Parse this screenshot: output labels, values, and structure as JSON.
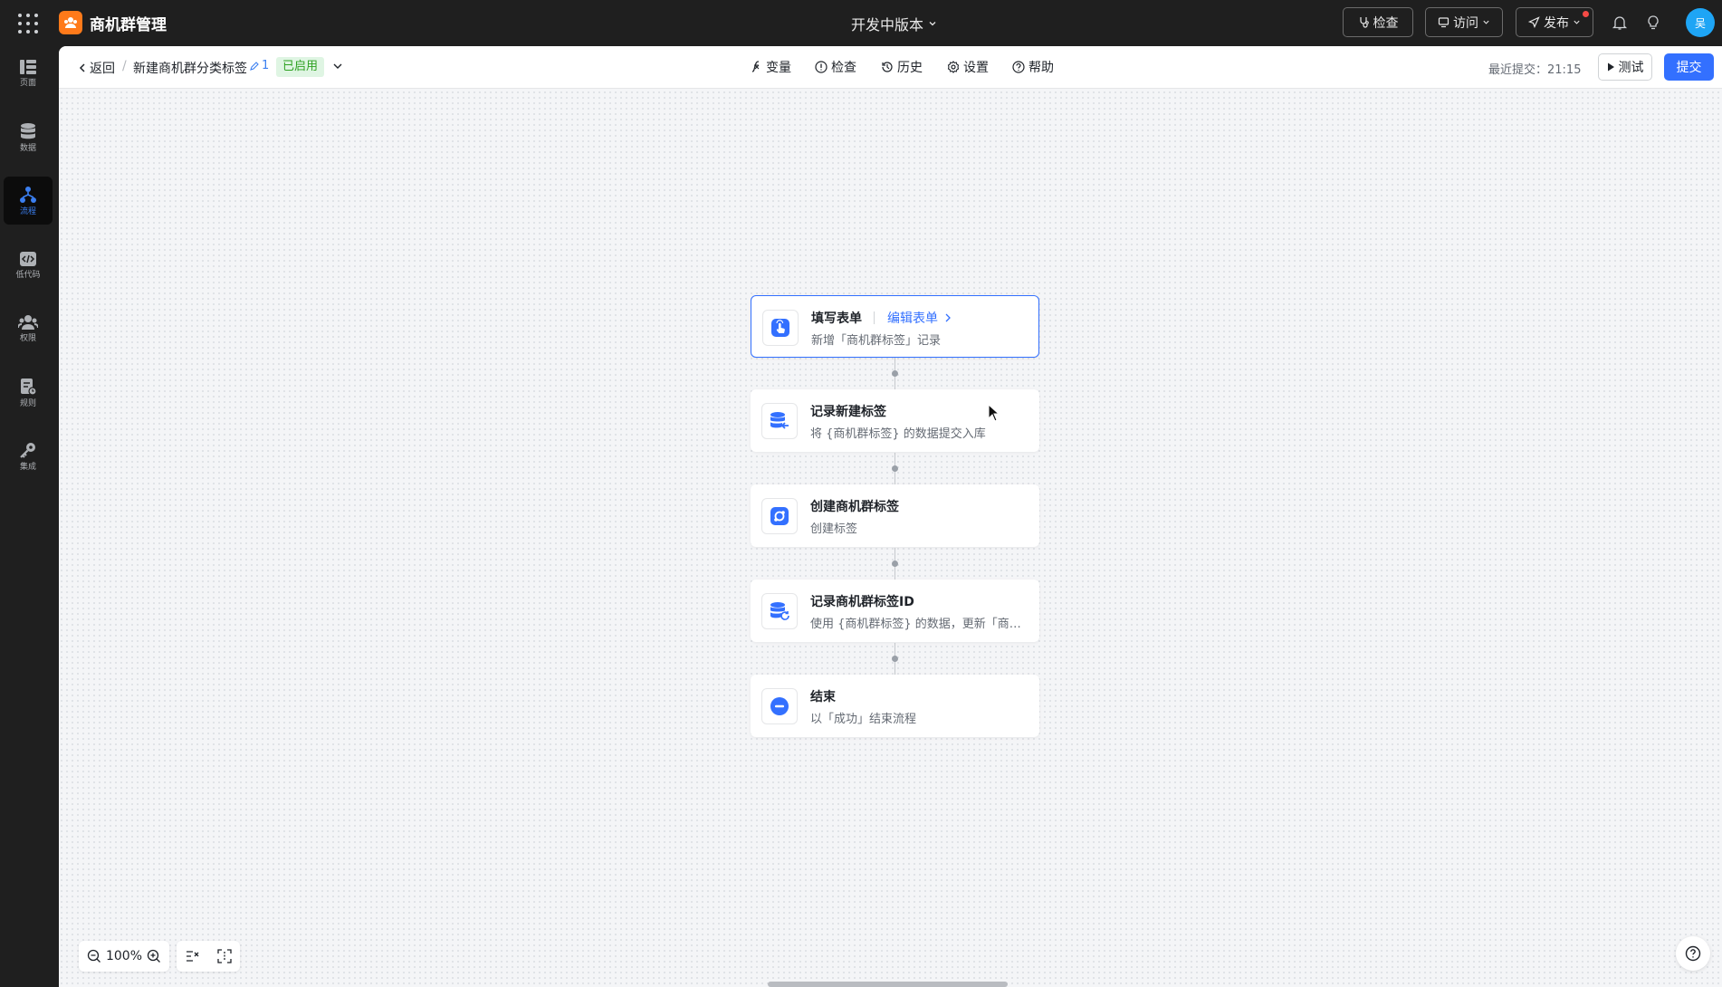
{
  "app": {
    "title": "商机群管理",
    "version_label": "开发中版本"
  },
  "topbar": {
    "check_label": "检查",
    "visit_label": "访问",
    "publish_label": "发布",
    "avatar_text": "吴"
  },
  "sidebar": {
    "items": [
      {
        "label": "页面",
        "icon": "page-icon"
      },
      {
        "label": "数据",
        "icon": "database-icon"
      },
      {
        "label": "流程",
        "icon": "flow-icon",
        "active": true
      },
      {
        "label": "低代码",
        "icon": "code-icon"
      },
      {
        "label": "权限",
        "icon": "users-icon"
      },
      {
        "label": "规则",
        "icon": "rule-icon"
      },
      {
        "label": "集成",
        "icon": "key-icon"
      }
    ]
  },
  "subbar": {
    "back_label": "返回",
    "separator": "/",
    "flow_name": "新建商机群分类标签",
    "version_num": "1",
    "status": "已启用",
    "tools": [
      "变量",
      "检查",
      "历史",
      "设置",
      "帮助"
    ],
    "last_commit": "最近提交：21:15",
    "test_label": "测试",
    "submit_label": "提交"
  },
  "nodes": [
    {
      "title": "填写表单",
      "link": "编辑表单",
      "desc": "新增「商机群标签」记录",
      "icon": "hand-pointer-icon"
    },
    {
      "title": "记录新建标签",
      "desc": "将 {商机群标签} 的数据提交入库",
      "icon": "db-import-icon"
    },
    {
      "title": "创建商机群标签",
      "desc": "创建标签",
      "icon": "connector-icon"
    },
    {
      "title": "记录商机群标签ID",
      "desc": "使用 {商机群标签} 的数据，更新「商…",
      "icon": "db-update-icon"
    },
    {
      "title": "结束",
      "desc": "以「成功」结束流程",
      "icon": "end-icon"
    }
  ],
  "zoom": {
    "level": "100%"
  },
  "colors": {
    "accent": "#3370ff",
    "enabled_green": "#2ea121",
    "logo_orange": "#ff7a1a"
  }
}
